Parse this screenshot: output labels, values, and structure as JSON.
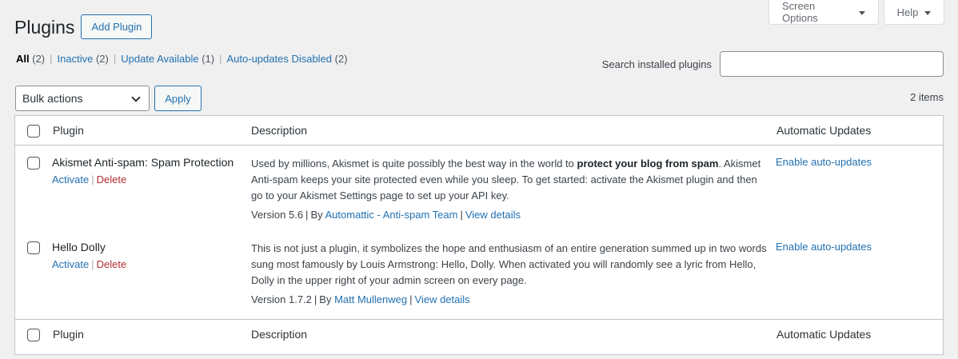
{
  "header": {
    "screen_options": "Screen Options",
    "help": "Help",
    "title": "Plugins",
    "add_button": "Add Plugin"
  },
  "filters": [
    {
      "label": "All",
      "count": "(2)"
    },
    {
      "label": "Inactive",
      "count": "(2)"
    },
    {
      "label": "Update Available",
      "count": "(1)"
    },
    {
      "label": "Auto-updates Disabled",
      "count": "(2)"
    }
  ],
  "search": {
    "label": "Search installed plugins",
    "value": ""
  },
  "tablenav": {
    "bulk_selected": "Bulk actions",
    "apply": "Apply",
    "items_count": "2 items"
  },
  "columns": {
    "plugin": "Plugin",
    "description": "Description",
    "auto_updates": "Automatic Updates"
  },
  "plugins": [
    {
      "name": "Akismet Anti-spam: Spam Protection",
      "activate": "Activate",
      "delete": "Delete",
      "desc_pre": "Used by millions, Akismet is quite possibly the best way in the world to ",
      "desc_bold": "protect your blog from spam",
      "desc_post": ". Akismet Anti-spam keeps your site protected even while you sleep. To get started: activate the Akismet plugin and then go to your Akismet Settings page to set up your API key.",
      "version": "Version 5.6",
      "by": "By",
      "author": "Automattic - Anti-spam Team",
      "view_details": "View details",
      "auto_update": "Enable auto-updates"
    },
    {
      "name": "Hello Dolly",
      "activate": "Activate",
      "delete": "Delete",
      "desc_pre": "This is not just a plugin, it symbolizes the hope and enthusiasm of an entire generation summed up in two words sung most famously by Louis Armstrong: Hello, Dolly. When activated you will randomly see a lyric from Hello, Dolly in the upper right of your admin screen on every page.",
      "desc_bold": "",
      "desc_post": "",
      "version": "Version 1.7.2",
      "by": "By",
      "author": "Matt Mullenweg",
      "view_details": "View details",
      "auto_update": "Enable auto-updates"
    }
  ],
  "colors": {
    "link": "#2271b1",
    "delete": "#b32d2e",
    "background": "#f0f0f1"
  }
}
